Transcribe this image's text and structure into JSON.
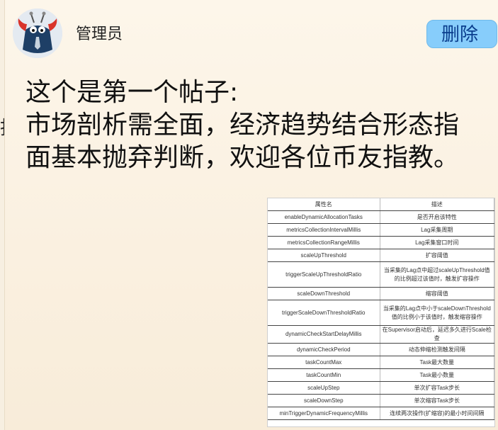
{
  "user": {
    "name": "管理员",
    "avatar_icon": "mascot-avatar"
  },
  "actions": {
    "delete_label": "删除"
  },
  "post": {
    "lines": [
      "这个是第一个帖子:",
      "市场剖析需全面，经济趋势结合形态指",
      "面基本抛弃判断，欢迎各位币友指教。"
    ]
  },
  "left_edge_glyph": "指",
  "table": {
    "headers": [
      "属性名",
      "描述"
    ],
    "rows": [
      [
        "enableDynamicAllocationTasks",
        "是否开启该特性"
      ],
      [
        "metricsCollectionIntervalMillis",
        "Lag采集周期"
      ],
      [
        "metricsCollectionRangeMillis",
        "Lag采集窗口时间"
      ],
      [
        "scaleUpThreshold",
        "扩容阈值"
      ],
      [
        "triggerScaleUpThresholdRatio",
        "当采集的Lag点中超过scaleUpThreshold值的比例超过该值时，触发扩容操作"
      ],
      [
        "scaleDownThreshold",
        "缩容阈值"
      ],
      [
        "triggerScaleDownThresholdRatio",
        "当采集的Lag点中小于scaleDownThreshold值的比例小于该值时，触发缩容操作"
      ],
      [
        "dynamicCheckStartDelayMillis",
        "在Supervisor启动后，延迟多久进行Scale检查"
      ],
      [
        "dynamicCheckPeriod",
        "动态伸缩检测触发间隔"
      ],
      [
        "taskCountMax",
        "Task最大数量"
      ],
      [
        "taskCountMin",
        "Task最小数量"
      ],
      [
        "scaleUpStep",
        "单次扩容Task步长"
      ],
      [
        "scaleDownStep",
        "单次缩容Task步长"
      ],
      [
        "minTriggerDynamicFrequencyMillis",
        "连续两次操作(扩缩容)的最小时间间隔"
      ]
    ],
    "tall_rows": [
      4,
      6
    ]
  }
}
